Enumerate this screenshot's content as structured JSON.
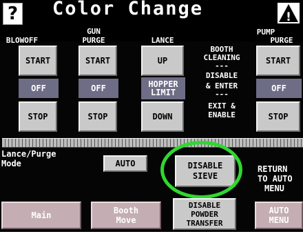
{
  "header": {
    "title": "Color Change",
    "help_symbol": "?",
    "warning_symbol": "!"
  },
  "columns": {
    "blowoff": {
      "heading": "BLOWOFF",
      "start": "START",
      "status": "OFF",
      "stop": "STOP"
    },
    "gun_purge": {
      "heading1": "GUN",
      "heading2": "PURGE",
      "start": "START",
      "status": "OFF",
      "stop": "STOP"
    },
    "lance": {
      "heading": "LANCE",
      "up": "UP",
      "status1": "HOPPER",
      "status2": "LIMIT",
      "down": "DOWN"
    },
    "booth": {
      "l1": "BOOTH",
      "l2": "CLEANING",
      "l3": "---",
      "l4": "DISABLE",
      "l5": "& ENTER",
      "l6": "---",
      "l7": "EXIT &",
      "l8": "ENABLE"
    },
    "pump_purge": {
      "heading1": "PUMP",
      "heading2": "PURGE",
      "start": "START",
      "status": "OFF",
      "stop": "STOP"
    }
  },
  "lance_purge": {
    "label1": "Lance/Purge",
    "label2": "Mode",
    "mode_button": "AUTO"
  },
  "disable_sieve": {
    "line1": "DISABLE",
    "line2": "SIEVE"
  },
  "return_info": {
    "l1": "RETURN",
    "l2": "TO AUTO",
    "l3": "MENU"
  },
  "nav": {
    "main": "Main",
    "booth_move1": "Booth",
    "booth_move2": "Move",
    "disable_powder1": "DISABLE",
    "disable_powder2": "POWDER",
    "disable_powder3": "TRANSFER",
    "auto_menu1": "AUTO",
    "auto_menu2": "MENU"
  },
  "colors": {
    "status_bg": "#6d6d86",
    "highlight_ring": "#2fd82f",
    "nav_button": "#c4aeb4"
  }
}
